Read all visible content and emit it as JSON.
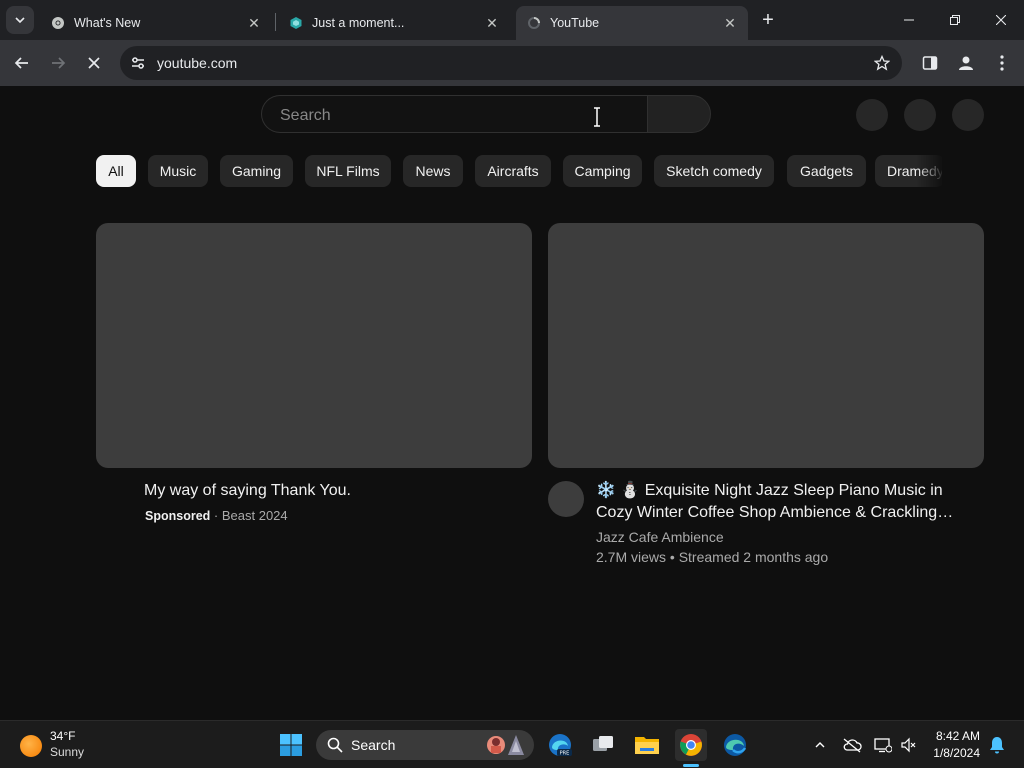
{
  "browser": {
    "tabs": [
      {
        "title": "What's New",
        "active": false
      },
      {
        "title": "Just a moment...",
        "active": false
      },
      {
        "title": "YouTube",
        "active": true
      }
    ],
    "url": "youtube.com"
  },
  "youtube": {
    "search_placeholder": "Search",
    "chips": [
      "All",
      "Music",
      "Gaming",
      "NFL Films",
      "News",
      "Aircrafts",
      "Camping",
      "Sketch comedy",
      "Gadgets",
      "Dramedy"
    ],
    "videos": [
      {
        "title": "My way of saying Thank You.",
        "sponsored_label": "Sponsored",
        "separator": " · ",
        "channel": "Beast 2024"
      },
      {
        "title_line1": "❄️ ⛄ Exquisite Night Jazz Sleep Piano Music in",
        "title_line2": "Cozy Winter Coffee Shop Ambience & Crackling…",
        "channel": "Jazz Cafe Ambience",
        "stats": "2.7M views • Streamed 2 months ago"
      }
    ]
  },
  "taskbar": {
    "weather_temp": "34°F",
    "weather_condition": "Sunny",
    "search_label": "Search",
    "time": "8:42 AM",
    "date": "1/8/2024"
  },
  "colors": {
    "page_bg": "#0f0f0f",
    "chip_bg": "#272727",
    "chip_selected_bg": "#f1f1f1",
    "placeholder_thumb": "#3d3d3d",
    "browser_frame": "#202124",
    "browser_toolbar": "#35363a"
  }
}
